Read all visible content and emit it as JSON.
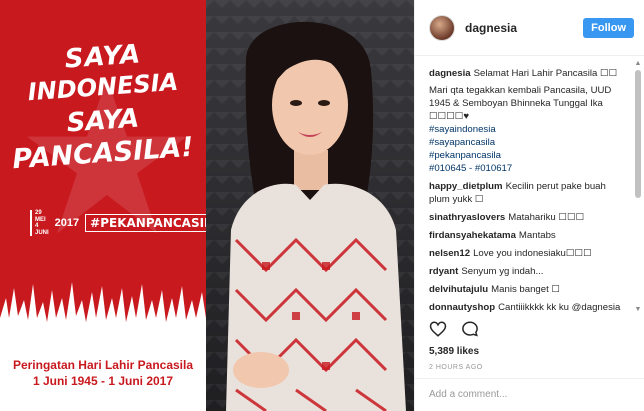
{
  "poster": {
    "line1": "SAYA",
    "line2": "INDONESIA",
    "line3": "SAYA",
    "line4": "PANCASILA!",
    "date_small_1": "29 MEI",
    "date_small_2": "4 JUNI",
    "year": "2017",
    "hashtag": "#PEKANPANCASILA",
    "footer_line1": "Peringatan Hari Lahir Pancasila",
    "footer_line2": "1 Juni 1945 - 1 Juni 2017"
  },
  "header": {
    "username": "dagnesia",
    "follow_label": "Follow"
  },
  "caption": {
    "username": "dagnesia",
    "text1": "Selamat Hari Lahir Pancasila ☐☐",
    "text2": "Mari qta tegakkan kembali Pancasila, UUD 1945 & Semboyan Bhinneka Tunggal Ika ☐☐☐☐♥",
    "tags": [
      "#sayaindonesia",
      "#sayapancasila",
      "#pekanpancasila",
      "#010645 - #010617"
    ]
  },
  "comments": [
    {
      "user": "happy_dietplum",
      "text": "Kecilin perut pake buah plum yukk ☐"
    },
    {
      "user": "sinathryaslovers",
      "text": "Matahariku ☐☐☐"
    },
    {
      "user": "firdansyahekatama",
      "text": "Mantabs"
    },
    {
      "user": "nelsen12",
      "text": "Love you indonesiaku☐☐☐"
    },
    {
      "user": "rdyant",
      "text": "Senyum yg indah..."
    },
    {
      "user": "delvihutajulu",
      "text": "Manis banget ☐"
    },
    {
      "user": "donnautyshop",
      "text": "Cantiiikkkk kk ku @dagnesia ☐☐"
    }
  ],
  "likes": "5,389 likes",
  "timestamp": "2 HOURS AGO",
  "add_comment_placeholder": "Add a comment...",
  "colors": {
    "poster_red": "#c8191f",
    "follow_blue": "#3897f0",
    "hashtag_blue": "#003569"
  },
  "icons": {
    "like": "heart-icon",
    "comment": "comment-bubble-icon"
  }
}
